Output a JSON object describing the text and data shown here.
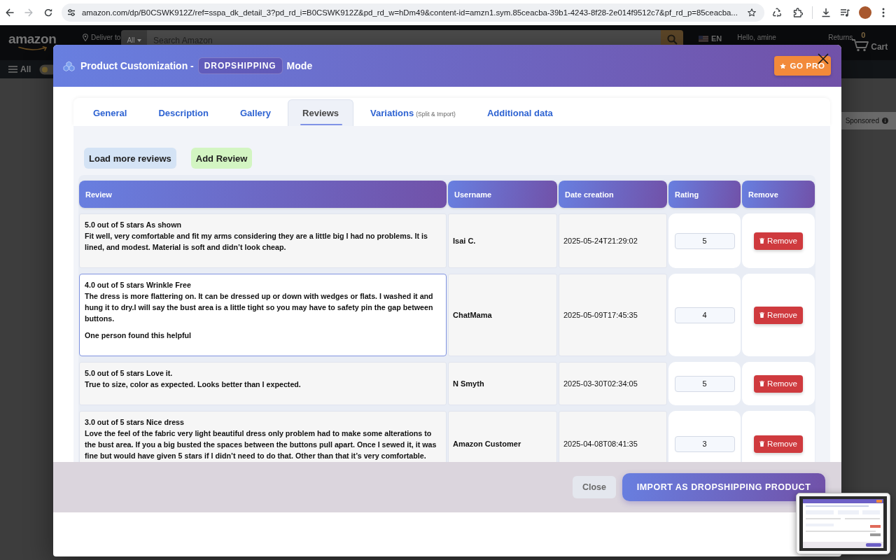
{
  "browser": {
    "url": "amazon.com/dp/B0CSWK912Z/ref=sspa_dk_detail_3?pd_rd_i=B0CSWK912Z&pd_rd_w=hDm49&content-id=amzn1.sym.85ceacba-39b1-4243-8f28-2e014f9512c7&pf_rd_p=85ceacba...",
    "can_go_forward": false
  },
  "background_page": {
    "logo": "amazon",
    "deliver_label": "Deliver to",
    "search_category": "All",
    "search_placeholder": "Search Amazon",
    "language": "EN",
    "greeting": "Hello, amine",
    "returns_label": "Returns",
    "cart_count": "0",
    "cart_label": "Cart",
    "nav_menu_label": "All",
    "sponsored_label": "Sponsored"
  },
  "modal": {
    "title": "Product Customization -",
    "mode_badge": "DROPSHIPPING",
    "title_suffix": "Mode",
    "upgrade_button": "GO PRO",
    "tabs": [
      {
        "label": "General",
        "selected": false
      },
      {
        "label": "Description",
        "selected": false
      },
      {
        "label": "Gallery",
        "selected": false
      },
      {
        "label": "Reviews",
        "selected": true
      },
      {
        "label": "Variations",
        "note": "(Split & Import)",
        "selected": false
      },
      {
        "label": "Additional data",
        "selected": false
      }
    ],
    "actions": [
      {
        "label": "Load more reviews",
        "kind": "info"
      },
      {
        "label": "Add Review",
        "kind": "success"
      }
    ],
    "table": {
      "columns": [
        "Review",
        "Username",
        "Date creation",
        "Rating",
        "Remove"
      ],
      "rows": [
        {
          "title": "5.0 out of 5 stars As shown",
          "body": "Fit well, very comfortable and fit my arms considering they are a little big I had no problems. It is lined, and modest. Material is soft and didn’t look cheap.",
          "username": "Isai C.",
          "date": "2025-05-24T21:29:02",
          "rating": "5",
          "remove_button": "Remove",
          "focused": false
        },
        {
          "title": "4.0 out of 5 stars Wrinkle Free",
          "body": "The dress is more flattering on. It can be dressed up or down with wedges or flats. I washed it and hung it to dry.I will say the bust area is a little tight so you may have to safety pin the gap between buttons.",
          "helpful": "One person found this helpful",
          "username": "ChatMama",
          "date": "2025-05-09T17:45:35",
          "rating": "4",
          "remove_button": "Remove",
          "focused": true
        },
        {
          "title": "5.0 out of 5 stars Love it.",
          "body": "True to size, color as expected. Looks better than I expected.",
          "username": "N Smyth",
          "date": "2025-03-30T02:34:05",
          "rating": "5",
          "remove_button": "Remove",
          "focused": false
        },
        {
          "title": "3.0 out of 5 stars Nice dress",
          "body": "Love the feel of the fabric very light beautiful dress only problem had to make some alterations to the bust area. If you a big busted the spaces between the buttons pull apart. Once I sewed it, it was fine but would have given 5 stars if I didn’t need to do that. Other than that it’s very comfortable.",
          "username": "Amazon Customer",
          "date": "2025-04-08T08:41:35",
          "rating": "3",
          "remove_button": "Remove",
          "focused": false
        }
      ]
    },
    "footer_buttons": [
      {
        "label": "Close",
        "kind": "secondary"
      },
      {
        "label": "IMPORT AS DROPSHIPPING PRODUCT",
        "kind": "primary"
      }
    ]
  }
}
